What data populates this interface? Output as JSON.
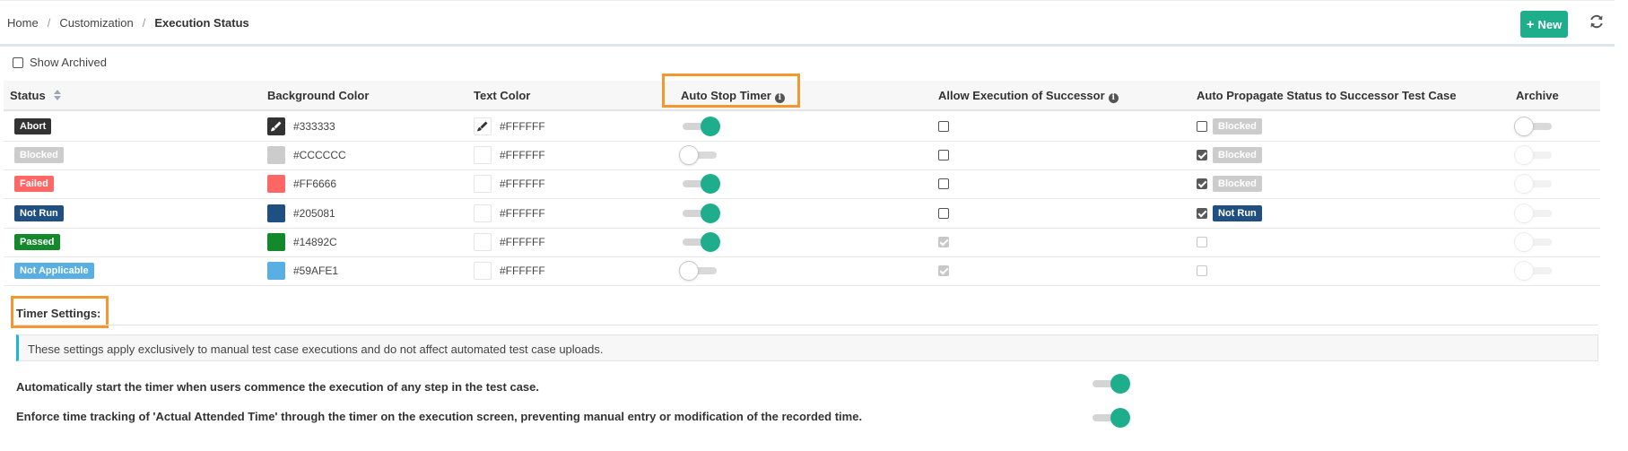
{
  "breadcrumb": {
    "home": "Home",
    "customization": "Customization",
    "current": "Execution Status"
  },
  "toolbar": {
    "new_label": "New"
  },
  "filters": {
    "show_archived_label": "Show Archived"
  },
  "table": {
    "headers": {
      "status": "Status",
      "background_color": "Background Color",
      "text_color": "Text Color",
      "auto_stop_timer": "Auto Stop Timer",
      "allow_execution": "Allow Execution of Successor",
      "auto_propagate": "Auto Propagate Status to Successor Test Case",
      "archive": "Archive"
    },
    "rows": [
      {
        "status": "Abort",
        "badge_color": "#333333",
        "bg_hex": "#333333",
        "text_hex": "#FFFFFF",
        "auto_stop": true,
        "allow_exec": false,
        "allow_exec_disabled": false,
        "propagate_checked": false,
        "propagate_disabled": false,
        "propagate_status": "Blocked",
        "propagate_color": "#CCCCCC"
      },
      {
        "status": "Blocked",
        "badge_color": "#CCCCCC",
        "bg_hex": "#CCCCCC",
        "text_hex": "#FFFFFF",
        "auto_stop": false,
        "allow_exec": false,
        "allow_exec_disabled": false,
        "propagate_checked": true,
        "propagate_disabled": false,
        "propagate_status": "Blocked",
        "propagate_color": "#CCCCCC"
      },
      {
        "status": "Failed",
        "badge_color": "#FF6666",
        "bg_hex": "#FF6666",
        "text_hex": "#FFFFFF",
        "auto_stop": true,
        "allow_exec": false,
        "allow_exec_disabled": false,
        "propagate_checked": true,
        "propagate_disabled": false,
        "propagate_status": "Blocked",
        "propagate_color": "#CCCCCC"
      },
      {
        "status": "Not Run",
        "badge_color": "#205081",
        "bg_hex": "#205081",
        "text_hex": "#FFFFFF",
        "auto_stop": true,
        "allow_exec": false,
        "allow_exec_disabled": false,
        "propagate_checked": true,
        "propagate_disabled": false,
        "propagate_status": "Not Run",
        "propagate_color": "#205081"
      },
      {
        "status": "Passed",
        "badge_color": "#14892C",
        "bg_hex": "#14892C",
        "text_hex": "#FFFFFF",
        "auto_stop": true,
        "allow_exec": true,
        "allow_exec_disabled": true,
        "propagate_checked": false,
        "propagate_disabled": true,
        "propagate_status": "",
        "propagate_color": ""
      },
      {
        "status": "Not Applicable",
        "badge_color": "#59AFE1",
        "bg_hex": "#59AFE1",
        "text_hex": "#FFFFFF",
        "auto_stop": false,
        "allow_exec": true,
        "allow_exec_disabled": true,
        "propagate_checked": false,
        "propagate_disabled": true,
        "propagate_status": "",
        "propagate_color": ""
      }
    ]
  },
  "timer_settings": {
    "title": "Timer Settings:",
    "info": "These settings apply exclusively to manual test case executions and do not affect automated test case uploads.",
    "settings": [
      {
        "label": "Automatically start the timer when users commence the execution of any step in the test case.",
        "enabled": true
      },
      {
        "label": "Enforce time tracking of 'Actual Attended Time' through the timer on the execution screen, preventing manual entry or modification of the recorded time.",
        "enabled": true
      }
    ]
  },
  "icons": {
    "new": "plus-icon",
    "refresh": "refresh-icon",
    "info": "info-icon",
    "sort": "sort-icon",
    "brush": "brush-icon"
  },
  "colors": {
    "accent": "#1FAE8B",
    "highlight": "#F2982E",
    "info_border": "#1AB8D1"
  }
}
